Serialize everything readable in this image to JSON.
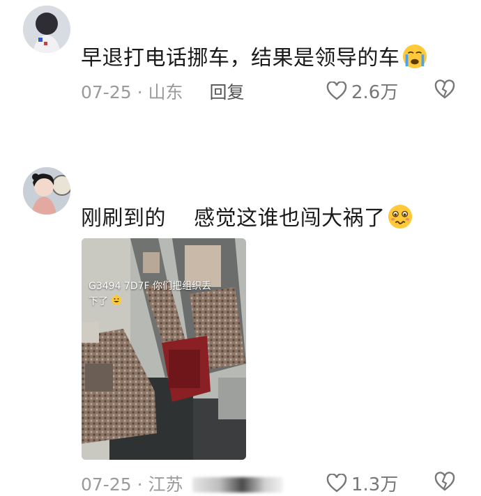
{
  "comments": [
    {
      "text": "早退打电话挪车，结果是领导的车",
      "emoji": "crying-face",
      "date": "07-25",
      "location": "山东",
      "reply_label": "回复",
      "likes": "2.6万"
    },
    {
      "text": "刚刷到的    感觉这谁也闯大祸了",
      "emoji": "anxious-face",
      "image_caption_line1": "G3494 7D7F 你们把组织丢",
      "image_caption_line2": "下了",
      "date": "07-25",
      "location": "江苏",
      "likes": "1.3万"
    }
  ],
  "separator": "·",
  "colors": {
    "meta": "#9a9a9a",
    "text": "#1a1a1a",
    "reply": "#555555"
  }
}
